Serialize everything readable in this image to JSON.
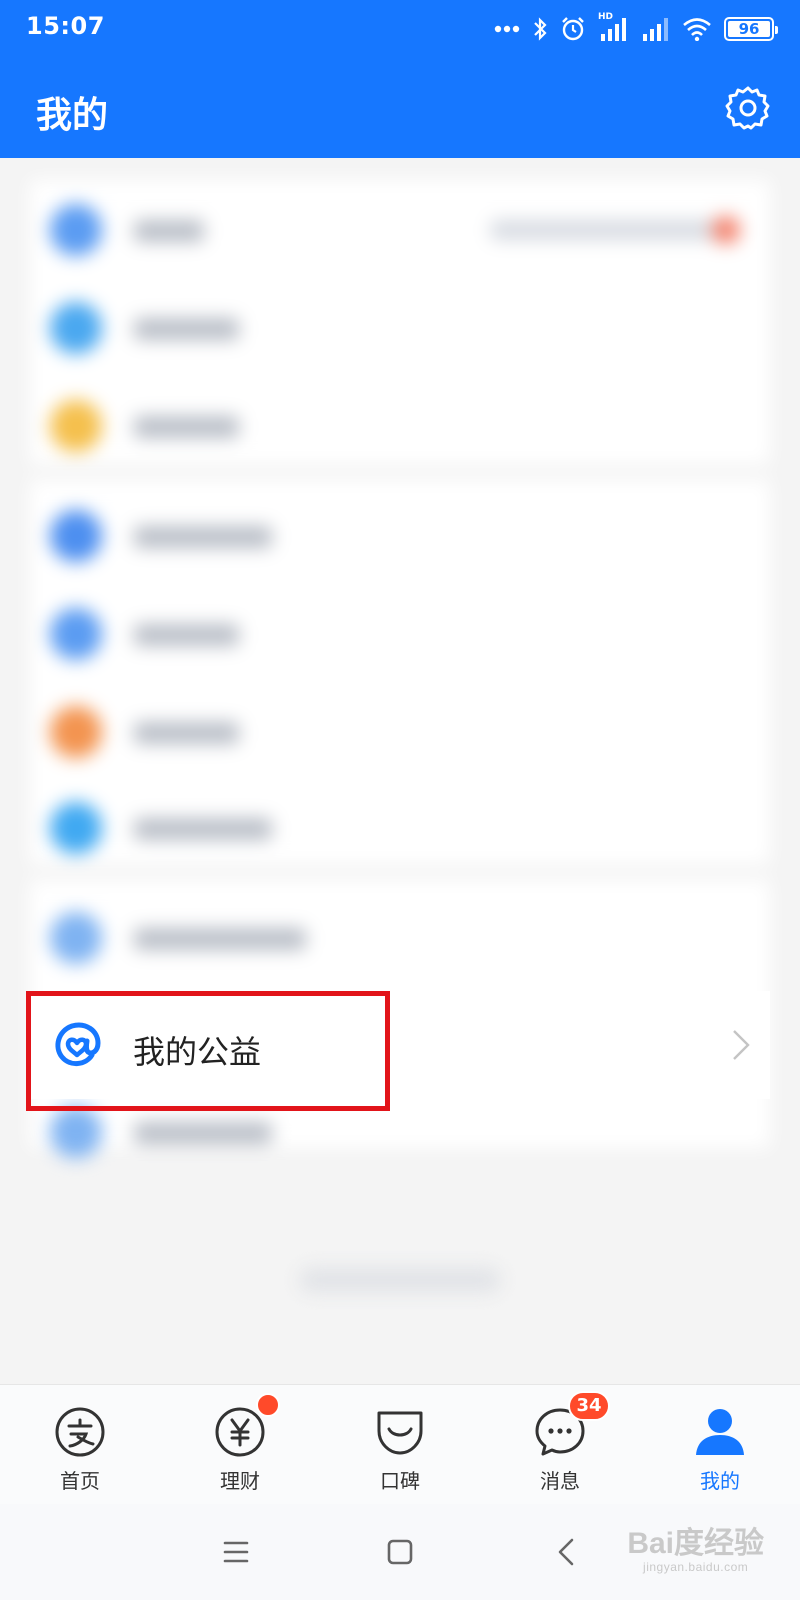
{
  "status_bar": {
    "time": "15:07",
    "battery": "96",
    "network_label": "HD",
    "icons": [
      "more-dots-icon",
      "bluetooth-icon",
      "alarm-icon",
      "signal-hd-icon",
      "signal-icon",
      "wifi-icon",
      "battery-icon"
    ]
  },
  "header": {
    "title": "我的",
    "settings_icon": "gear-icon"
  },
  "highlighted_item": {
    "label": "我的公益",
    "icon": "charity-icon",
    "chevron": "chevron-right-icon"
  },
  "tabs": [
    {
      "label": "首页",
      "icon": "alipay-home-icon",
      "active": false
    },
    {
      "label": "理财",
      "icon": "yen-icon",
      "active": false,
      "badge_dot": true
    },
    {
      "label": "口碑",
      "icon": "koubei-icon",
      "active": false
    },
    {
      "label": "消息",
      "icon": "chat-icon",
      "active": false,
      "badge": "34"
    },
    {
      "label": "我的",
      "icon": "person-icon",
      "active": true
    }
  ],
  "system_nav": {
    "buttons": [
      "menu-icon",
      "home-square-icon",
      "back-icon"
    ]
  },
  "watermark": {
    "text": "Bai度经验",
    "sub": "jingyan.baidu.com"
  },
  "colors": {
    "brand_blue": "#1677ff",
    "highlight_red": "#e2141a",
    "badge_red": "#ff4a2a"
  }
}
